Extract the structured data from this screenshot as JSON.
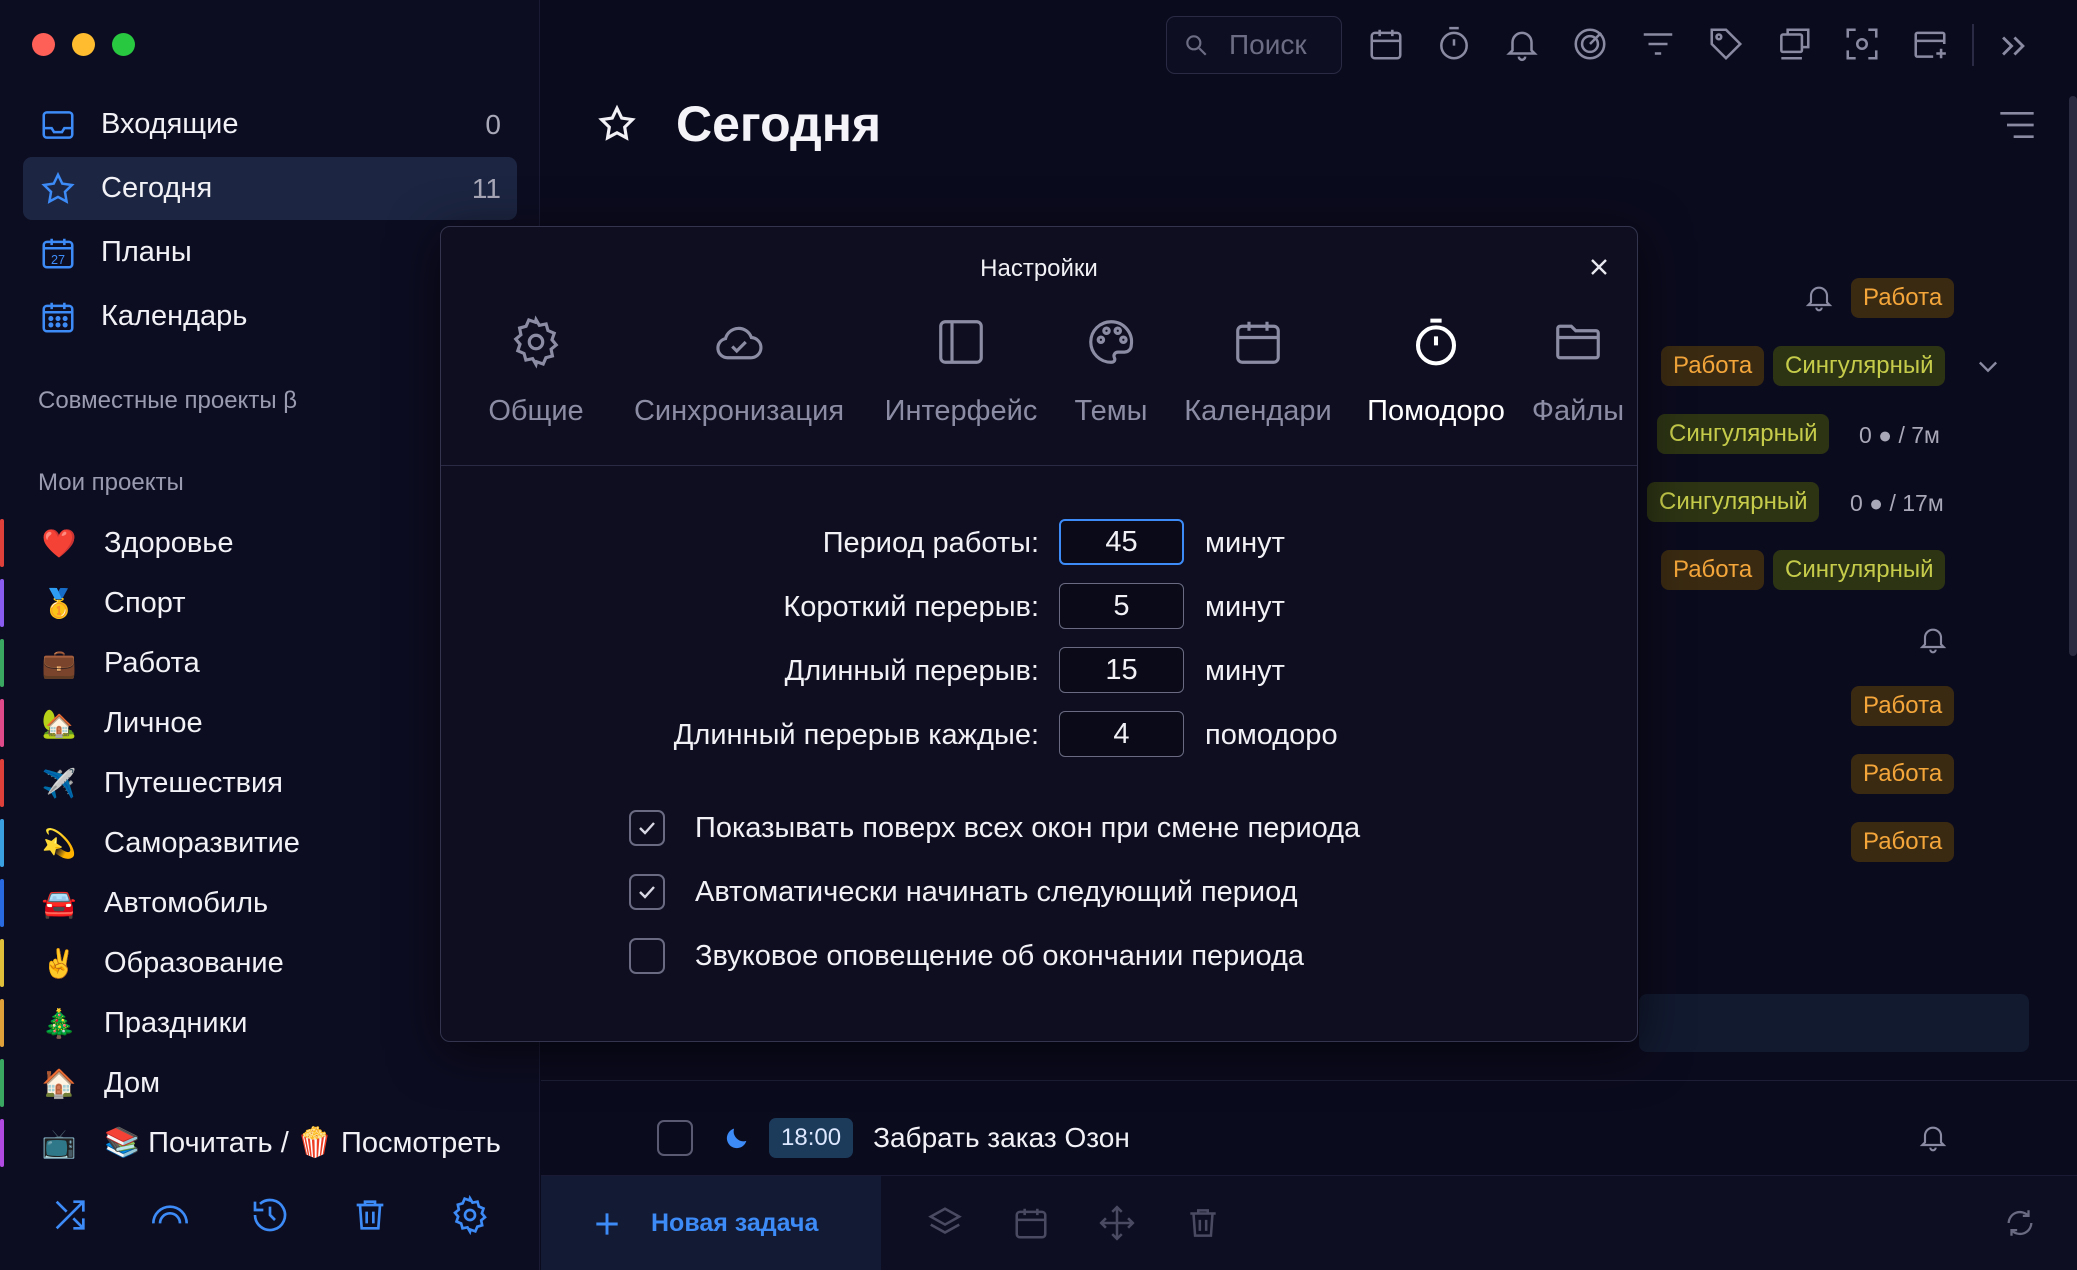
{
  "colors": {
    "accent": "#3d8bf7",
    "background": "#0b0b1e",
    "tag_work": "#f4a63a",
    "tag_singular": "#c6cc4a",
    "traffic_red": "#fe5f57",
    "traffic_yellow": "#febc2e",
    "traffic_green": "#28c840"
  },
  "sidebar": {
    "nav": [
      {
        "label": "Входящие",
        "count": "0",
        "icon": "inbox-icon"
      },
      {
        "label": "Сегодня",
        "count": "11",
        "icon": "star-icon",
        "active": true
      },
      {
        "label": "Планы",
        "count": "",
        "icon": "calendar-27-icon"
      },
      {
        "label": "Календарь",
        "count": "",
        "icon": "calendar-grid-icon"
      }
    ],
    "shared_title": "Совместные проекты β",
    "projects_title": "Мои проекты",
    "projects": [
      {
        "emoji": "❤️",
        "label": "Здоровье",
        "color": "#e0403a"
      },
      {
        "emoji": "🥇",
        "label": "Спорт",
        "color": "#8a5cf0"
      },
      {
        "emoji": "💼",
        "label": "Работа",
        "color": "#3aa860"
      },
      {
        "emoji": "🏡",
        "label": "Личное",
        "color": "#e04a8a"
      },
      {
        "emoji": "✈️",
        "label": "Путешествия",
        "color": "#e0403a"
      },
      {
        "emoji": "💫",
        "label": "Саморазвитие",
        "color": "#3aa0e0"
      },
      {
        "emoji": "🚘",
        "label": "Автомобиль",
        "color": "#2a6ae0"
      },
      {
        "emoji": "✌️",
        "label": "Образование",
        "color": "#e0c03a"
      },
      {
        "emoji": "🎄",
        "label": "Праздники",
        "color": "#e0a03a"
      },
      {
        "emoji": "🏠",
        "label": "Дом",
        "color": "#3aa860"
      },
      {
        "emoji": "📺",
        "label": "📚 Почитать / 🍿 Посмотреть",
        "color": "#b04ae0"
      }
    ],
    "bottom_icons": [
      "shuffle-icon",
      "rainbow-icon",
      "history-icon",
      "trash-icon",
      "gear-icon"
    ]
  },
  "main": {
    "search_placeholder": "Поиск",
    "title": "Сегодня",
    "toolbar_icons": [
      "calendar-icon",
      "timer-icon",
      "bell-icon",
      "target-icon",
      "filter-icon",
      "tag-icon",
      "layers-icon",
      "scan-icon",
      "add-calendar-icon"
    ],
    "tags": {
      "work": "Работа",
      "singular": "Сингулярный"
    },
    "meta": {
      "m1": "0 ● / 7м",
      "m2": "0 ● / 17м"
    },
    "task": {
      "time": "18:00",
      "title": "Забрать заказ Озон"
    },
    "new_task_label": "Новая задача"
  },
  "modal": {
    "title": "Настройки",
    "tabs": [
      {
        "label": "Общие",
        "icon": "gear-icon"
      },
      {
        "label": "Синхронизация",
        "icon": "cloud-check-icon"
      },
      {
        "label": "Интерфейс",
        "icon": "sidebar-layout-icon"
      },
      {
        "label": "Темы",
        "icon": "palette-icon"
      },
      {
        "label": "Календари",
        "icon": "calendar-icon"
      },
      {
        "label": "Помодоро",
        "icon": "stopwatch-icon",
        "active": true
      },
      {
        "label": "Файлы",
        "icon": "folder-icon"
      }
    ],
    "fields": [
      {
        "label": "Период работы:",
        "value": "45",
        "unit": "минут"
      },
      {
        "label": "Короткий перерыв:",
        "value": "5",
        "unit": "минут"
      },
      {
        "label": "Длинный перерыв:",
        "value": "15",
        "unit": "минут"
      },
      {
        "label": "Длинный перерыв каждые:",
        "value": "4",
        "unit": "помодоро"
      }
    ],
    "checks": [
      {
        "label": "Показывать поверх всех окон при смене периода",
        "checked": true
      },
      {
        "label": "Автоматически начинать следующий период",
        "checked": true
      },
      {
        "label": "Звуковое оповещение об окончании периода",
        "checked": false
      }
    ]
  }
}
